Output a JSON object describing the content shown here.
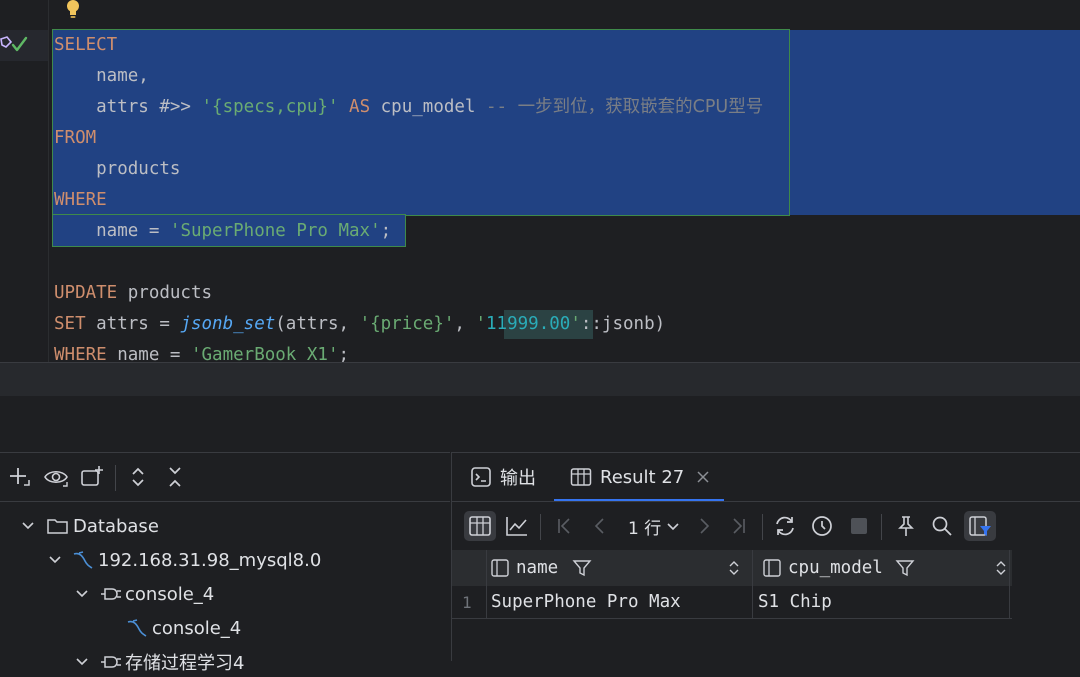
{
  "editor": {
    "lines": [
      {
        "parts": [
          {
            "t": "SELECT",
            "c": "kw"
          }
        ]
      },
      {
        "parts": [
          {
            "t": "    name,",
            "c": "pl"
          }
        ]
      },
      {
        "parts": [
          {
            "t": "    attrs ",
            "c": "pl"
          },
          {
            "t": "#>>",
            "c": "pl"
          },
          {
            "t": " ",
            "c": "pl"
          },
          {
            "t": "'{specs,cpu}'",
            "c": "str"
          },
          {
            "t": " ",
            "c": "pl"
          },
          {
            "t": "AS",
            "c": "kw"
          },
          {
            "t": " cpu_model ",
            "c": "pl"
          },
          {
            "t": "-- ",
            "c": "cm"
          },
          {
            "t": "一步到位，获取嵌套的CPU型号",
            "c": "cm cmcjk"
          }
        ]
      },
      {
        "parts": [
          {
            "t": "FROM",
            "c": "kw"
          }
        ]
      },
      {
        "parts": [
          {
            "t": "    products",
            "c": "pl"
          }
        ]
      },
      {
        "parts": [
          {
            "t": "WHERE",
            "c": "kw"
          }
        ]
      },
      {
        "parts": [
          {
            "t": "    name = ",
            "c": "pl"
          },
          {
            "t": "'SuperPhone Pro Max'",
            "c": "str"
          },
          {
            "t": ";",
            "c": "pl"
          }
        ]
      },
      {
        "parts": [
          {
            "t": "",
            "c": "pl"
          }
        ]
      },
      {
        "parts": [
          {
            "t": "UPDATE",
            "c": "kw"
          },
          {
            "t": " products",
            "c": "pl"
          }
        ]
      },
      {
        "parts": [
          {
            "t": "SET",
            "c": "kw"
          },
          {
            "t": " attrs = ",
            "c": "pl"
          },
          {
            "t": "jsonb_set",
            "c": "fn"
          },
          {
            "t": "(attrs, ",
            "c": "pl"
          },
          {
            "t": "'{price}'",
            "c": "str"
          },
          {
            "t": ", ",
            "c": "pl"
          },
          {
            "t": "'",
            "c": "str"
          },
          {
            "t": "11999.00",
            "c": "num"
          },
          {
            "t": "'",
            "c": "str"
          },
          {
            "t": "::jsonb)",
            "c": "pl"
          }
        ]
      },
      {
        "parts": [
          {
            "t": "WHERE",
            "c": "kw"
          },
          {
            "t": " name = ",
            "c": "pl"
          },
          {
            "t": "'GamerBook X1'",
            "c": "str"
          },
          {
            "t": ";",
            "c": "pl"
          }
        ]
      }
    ]
  },
  "tree": {
    "toolbar_icons": [
      "add-icon",
      "eye-icon",
      "new-console-icon",
      "expand-all-icon",
      "collapse-all-icon"
    ],
    "items": [
      {
        "label": "Database",
        "icon": "folder-icon",
        "expanded": true
      },
      {
        "label": "192.168.31.98_mysql8.0",
        "icon": "mysql-icon",
        "expanded": true
      },
      {
        "label": "console_4",
        "icon": "console-icon",
        "expanded": true
      },
      {
        "label": "console_4",
        "icon": "mysql-icon",
        "expanded": false
      },
      {
        "label": "存储过程学习4",
        "icon": "console-icon",
        "expanded": true
      }
    ]
  },
  "results": {
    "tabs": [
      {
        "label": "输出",
        "icon": "output-icon"
      },
      {
        "label": "Result 27",
        "icon": "table-icon",
        "active": true,
        "closable": true
      }
    ],
    "rows_selector": "1 行",
    "columns": [
      {
        "name": "name"
      },
      {
        "name": "cpu_model"
      }
    ],
    "rows": [
      {
        "index": "1",
        "values": [
          "SuperPhone Pro Max",
          "S1 Chip"
        ]
      }
    ],
    "accent": "#3574f0"
  }
}
